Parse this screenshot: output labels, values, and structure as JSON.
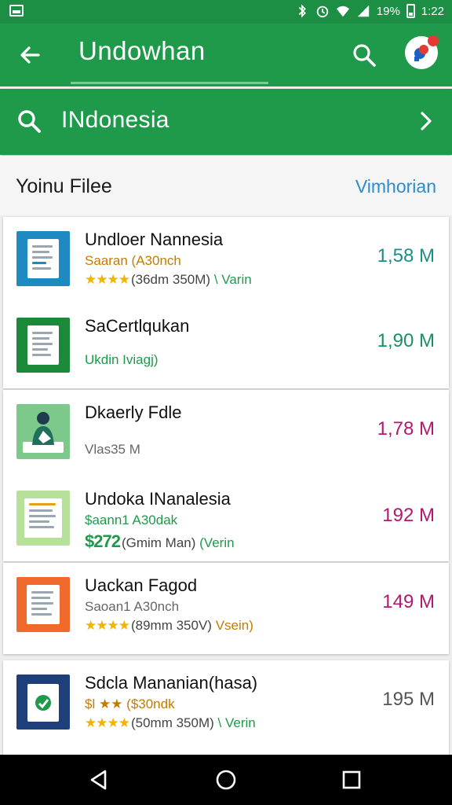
{
  "status_bar": {
    "battery_text": "19%",
    "time": "1:22"
  },
  "app_bar": {
    "title": "Undowhan"
  },
  "search": {
    "value": "INdonesia"
  },
  "section": {
    "title": "Yoinu Filee",
    "link": "Vimhorian"
  },
  "items": [
    {
      "name": "Undloer Nannesia",
      "sub": "Saaran (A30nch",
      "stars": "★★★★",
      "meta": "(36dm 350M)",
      "verif": "\\ Varin",
      "size": "1,58 M",
      "size_color": "#1a8f86",
      "sub_color": "#c57a00"
    },
    {
      "name": "SaCertlqukan",
      "sub": "Ukdin Iviagj)",
      "stars": "",
      "meta": "",
      "verif": "",
      "size": "1,90 M",
      "size_color": "#1a8f66",
      "sub_color": "#1e9a4a"
    },
    {
      "name": "Dkaerly Fdle",
      "sub": "Vlas35 M",
      "stars": "",
      "meta": "",
      "verif": "",
      "size": "1,78 M",
      "size_color": "#b3186e",
      "sub_color": "#666666"
    },
    {
      "name": "Undoka INanalesia",
      "sub": "$aann1 A30dak",
      "stars": "$272",
      "meta": "(Gmim Man)",
      "verif": "(Verin",
      "size": "192 M",
      "size_color": "#b3186e",
      "sub_color": "#1e9a4a"
    },
    {
      "name": "Uackan Fagod",
      "sub": "Saoan1 A30nch",
      "stars": "★★★★",
      "meta": "(89mm 350V)",
      "verif": "Vsein)",
      "size": "149 M",
      "size_color": "#b3186e",
      "sub_color": "#666666"
    },
    {
      "name": "Sdcla Mananian(hasa)",
      "sub": "$l ★★ ($30ndk",
      "stars": "★★★★",
      "meta": "(50mm 350M)",
      "verif": "\\ Verin",
      "size": "195 M",
      "size_color": "#555555",
      "sub_color": "#c57a00"
    }
  ],
  "colors": {
    "primary": "#1f9a4b",
    "link": "#2a8dcf"
  }
}
